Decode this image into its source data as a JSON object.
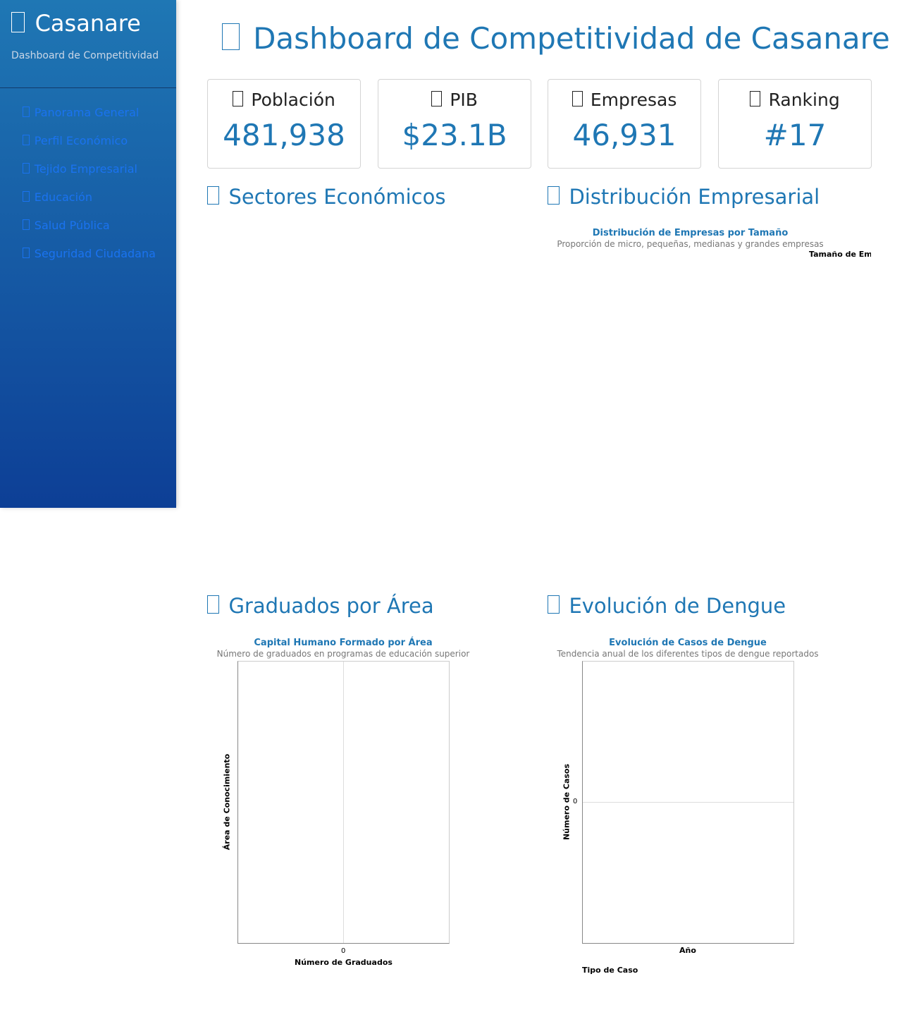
{
  "sidebar": {
    "brand": "Casanare",
    "subtitle": "Dashboard de Competitividad",
    "nav": [
      {
        "label": "Panorama General",
        "icon": "chart-icon"
      },
      {
        "label": "Perfil Económico",
        "icon": "money-icon"
      },
      {
        "label": "Tejido Empresarial",
        "icon": "building-icon"
      },
      {
        "label": "Educación",
        "icon": "graduation-icon"
      },
      {
        "label": "Salud Pública",
        "icon": "health-icon"
      },
      {
        "label": "Seguridad Ciudadana",
        "icon": "shield-icon"
      }
    ]
  },
  "header": {
    "title": "Dashboard de Competitividad de Casanare"
  },
  "kpis": [
    {
      "label": "Población",
      "value": "481,938",
      "icon": "people-icon"
    },
    {
      "label": "PIB",
      "value": "$23.1B",
      "icon": "money-icon"
    },
    {
      "label": "Empresas",
      "value": "46,931",
      "icon": "building-icon"
    },
    {
      "label": "Ranking",
      "value": "#17",
      "icon": "trophy-icon"
    }
  ],
  "sections": {
    "sectores": {
      "title": "Sectores Económicos",
      "icon": "industry-icon"
    },
    "distribucion": {
      "title": "Distribución Empresarial",
      "icon": "pie-icon",
      "chart_title": "Distribución de Empresas por Tamaño",
      "chart_subtitle": "Proporción de micro, pequeñas, medianas y grandes empresas",
      "legend_title": "Tamaño de Em"
    },
    "graduados": {
      "title": "Graduados por Área",
      "icon": "graduation-icon"
    },
    "dengue": {
      "title": "Evolución de Dengue",
      "icon": "health-icon"
    }
  },
  "colors": {
    "accent": "#1f77b4",
    "sidebar_top": "#1f77b4",
    "sidebar_bottom": "#0d3f96",
    "link": "#1a73f0"
  },
  "chart_data": [
    {
      "type": "bar",
      "title": "Capital Humano Formado por Área",
      "subtitle": "Número de graduados en programas de educación superior",
      "xlabel": "Número de Graduados",
      "ylabel": "Área de Conocimiento",
      "categories": [],
      "values": [],
      "x_ticks": [
        "0"
      ],
      "grid": true
    },
    {
      "type": "line",
      "title": "Evolución de Casos de Dengue",
      "subtitle": "Tendencia anual de los diferentes tipos de dengue reportados",
      "xlabel": "Año",
      "ylabel": "Número de Casos",
      "legend_title": "Tipo de Caso",
      "series": [],
      "y_ticks": [
        "0"
      ],
      "grid": true
    }
  ]
}
